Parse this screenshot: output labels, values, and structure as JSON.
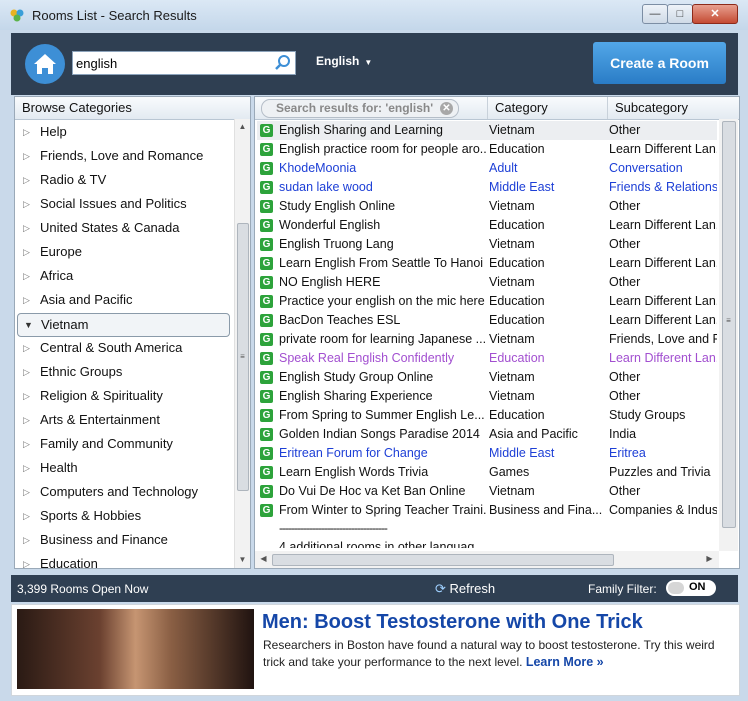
{
  "window": {
    "title": "Rooms List - Search Results"
  },
  "toolbar": {
    "search_value": "english",
    "language": "English",
    "create_room": "Create a Room"
  },
  "sidebar": {
    "header": "Browse Categories",
    "items": [
      {
        "label": "Help"
      },
      {
        "label": "Friends, Love and Romance"
      },
      {
        "label": "Radio & TV"
      },
      {
        "label": "Social Issues and Politics"
      },
      {
        "label": "United States & Canada"
      },
      {
        "label": "Europe"
      },
      {
        "label": "Africa"
      },
      {
        "label": "Asia and Pacific"
      },
      {
        "label": "Vietnam",
        "selected": true
      },
      {
        "label": "Central & South America"
      },
      {
        "label": "Ethnic Groups"
      },
      {
        "label": "Religion & Spirituality"
      },
      {
        "label": "Arts & Entertainment"
      },
      {
        "label": "Family and Community"
      },
      {
        "label": "Health"
      },
      {
        "label": "Computers and Technology"
      },
      {
        "label": "Sports & Hobbies"
      },
      {
        "label": "Business and Finance"
      },
      {
        "label": "Education"
      }
    ]
  },
  "results": {
    "search_tag": "Search results for: 'english'",
    "columns": {
      "category": "Category",
      "subcategory": "Subcategory"
    },
    "rows": [
      {
        "name": "English Sharing and Learning",
        "category": "Vietnam",
        "subcategory": "Other",
        "style": "sel"
      },
      {
        "name": "English practice room for people aro...",
        "category": "Education",
        "subcategory": "Learn Different Lan...",
        "style": ""
      },
      {
        "name": "KhodeMoonia",
        "category": "Adult",
        "subcategory": "Conversation",
        "style": "blue"
      },
      {
        "name": "sudan lake wood",
        "category": "Middle East",
        "subcategory": "Friends & Relations",
        "style": "blue"
      },
      {
        "name": "Study English Online",
        "category": "Vietnam",
        "subcategory": "Other",
        "style": ""
      },
      {
        "name": "Wonderful English",
        "category": "Education",
        "subcategory": "Learn Different Lan...",
        "style": ""
      },
      {
        "name": "English Truong Lang",
        "category": "Vietnam",
        "subcategory": "Other",
        "style": ""
      },
      {
        "name": "Learn English From Seattle To Hanoi",
        "category": "Education",
        "subcategory": "Learn Different Lan...",
        "style": ""
      },
      {
        "name": "NO English HERE",
        "category": "Vietnam",
        "subcategory": "Other",
        "style": ""
      },
      {
        "name": "Practice your english on the mic here",
        "category": "Education",
        "subcategory": "Learn Different Lan...",
        "style": ""
      },
      {
        "name": "BacDon Teaches ESL",
        "category": "Education",
        "subcategory": "Learn Different Lan...",
        "style": ""
      },
      {
        "name": "private room for learning Japanese ...",
        "category": "Vietnam",
        "subcategory": "Friends, Love and R",
        "style": ""
      },
      {
        "name": "Speak Real English Confidently",
        "category": "Education",
        "subcategory": "Learn Different Lan...",
        "style": "purple"
      },
      {
        "name": "English Study Group Online",
        "category": "Vietnam",
        "subcategory": "Other",
        "style": ""
      },
      {
        "name": "English Sharing Experience",
        "category": "Vietnam",
        "subcategory": "Other",
        "style": ""
      },
      {
        "name": "From Spring to Summer English Le...",
        "category": "Education",
        "subcategory": "Study Groups",
        "style": ""
      },
      {
        "name": "Golden Indian Songs Paradise 2014",
        "category": "Asia and Pacific",
        "subcategory": "India",
        "style": ""
      },
      {
        "name": "Eritrean Forum for Change",
        "category": "Middle East",
        "subcategory": "Eritrea",
        "style": "blue"
      },
      {
        "name": "Learn English Words Trivia",
        "category": "Games",
        "subcategory": "Puzzles and Trivia",
        "style": ""
      },
      {
        "name": "Do Vui De Hoc va Ket Ban Online",
        "category": "Vietnam",
        "subcategory": "Other",
        "style": ""
      },
      {
        "name": "From Winter to Spring Teacher Traini...",
        "category": "Business and Fina...",
        "subcategory": "Companies & Indus...",
        "style": ""
      }
    ],
    "separator": "------------------------------------",
    "more_text": "4 additional rooms in other languag..."
  },
  "statusbar": {
    "rooms_open": "3,399 Rooms Open Now",
    "refresh": "Refresh",
    "family_filter": "Family Filter:",
    "toggle": "ON"
  },
  "ad": {
    "headline": "Men: Boost Testosterone with One Trick",
    "body": "Researchers in Boston have found a natural way to boost testosterone. Try this weird trick and take your performance to the next level.",
    "learn_more": "Learn More »"
  },
  "colors": {
    "toolbar": "#2f3f52",
    "accent": "#3d8fd6",
    "room_icon": "#2da33b",
    "link_blue": "#1d3fd6",
    "link_purple": "#a24fd0"
  }
}
